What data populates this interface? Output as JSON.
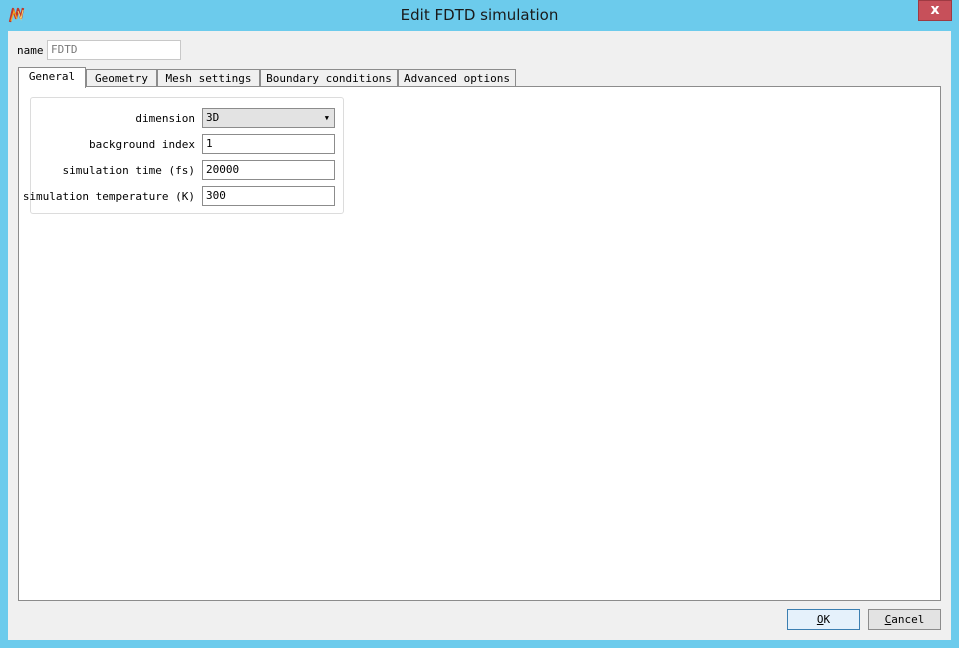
{
  "window": {
    "title": "Edit FDTD simulation",
    "close_label": "x",
    "accent_color": "#6ccbec",
    "close_color": "#c7505a"
  },
  "name_field": {
    "label": "name",
    "value": "FDTD"
  },
  "tabs": [
    {
      "label": "General",
      "active": true
    },
    {
      "label": "Geometry",
      "active": false
    },
    {
      "label": "Mesh settings",
      "active": false
    },
    {
      "label": "Boundary conditions",
      "active": false
    },
    {
      "label": "Advanced options",
      "active": false
    }
  ],
  "general": {
    "dimension": {
      "label": "dimension",
      "value": "3D",
      "arrow_icon": "dropdown-arrow-icon"
    },
    "background_index": {
      "label": "background index",
      "value": "1"
    },
    "simulation_time": {
      "label": "simulation time (fs)",
      "value": "20000"
    },
    "simulation_temperature": {
      "label": "simulation temperature (K)",
      "value": "300"
    }
  },
  "buttons": {
    "ok_mnemonic": "O",
    "ok_rest": "K",
    "cancel_mnemonic": "C",
    "cancel_rest": "ancel"
  }
}
